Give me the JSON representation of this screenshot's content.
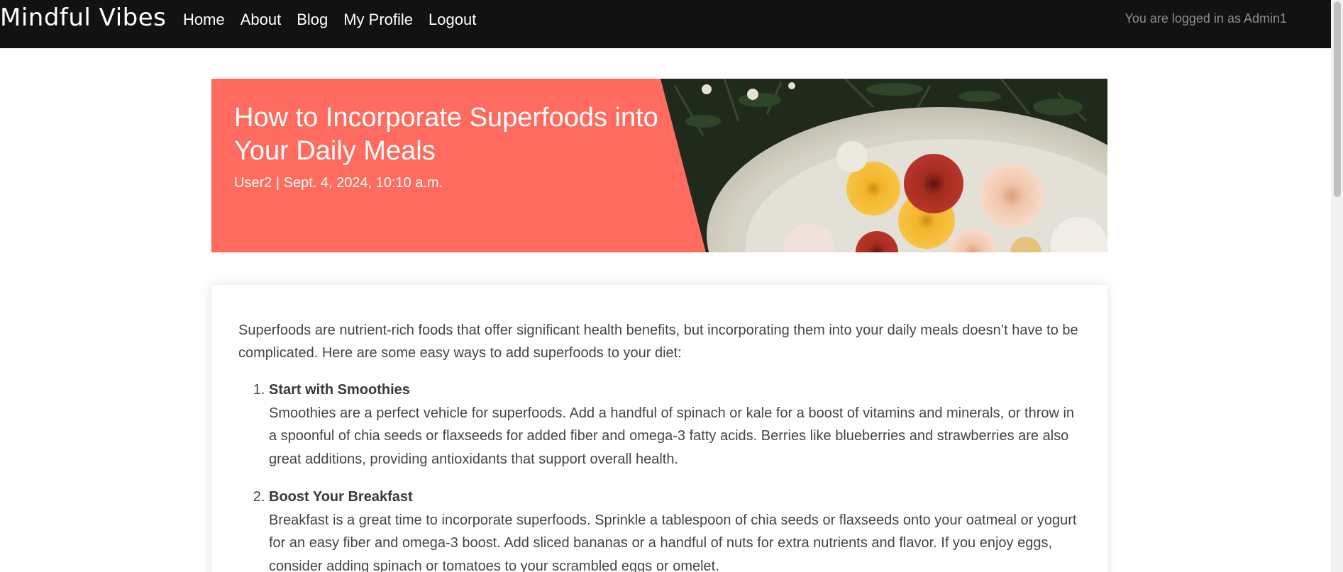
{
  "navbar": {
    "brand": "Mindful Vibes",
    "links": [
      "Home",
      "About",
      "Blog",
      "My Profile",
      "Logout"
    ],
    "status": "You are logged in as Admin1"
  },
  "post": {
    "title": "How to Incorporate Superfoods into Your Daily Meals",
    "meta": "User2 | Sept. 4, 2024, 10:10 a.m.",
    "intro": "Superfoods are nutrient-rich foods that offer significant health benefits, but incorporating them into your daily meals doesn’t have to be complicated. Here are some easy ways to add superfoods to your diet:",
    "items": [
      {
        "title": "Start with Smoothies",
        "body": "Smoothies are a perfect vehicle for superfoods. Add a handful of spinach or kale for a boost of vitamins and minerals, or throw in a spoonful of chia seeds or flaxseeds for added fiber and omega-3 fatty acids. Berries like blueberries and strawberries are also great additions, providing antioxidants that support overall health."
      },
      {
        "title": "Boost Your Breakfast",
        "body": "Breakfast is a great time to incorporate superfoods. Sprinkle a tablespoon of chia seeds or flaxseeds onto your oatmeal or yogurt for an easy fiber and omega-3 boost. Add sliced bananas or a handful of nuts for extra nutrients and flavor. If you enjoy eggs, consider adding spinach or tomatoes to your scrambled eggs or omelet."
      }
    ]
  },
  "colors": {
    "navbar_bg": "#121212",
    "hero_accent": "#ff6b5e",
    "body_text": "#454545"
  }
}
